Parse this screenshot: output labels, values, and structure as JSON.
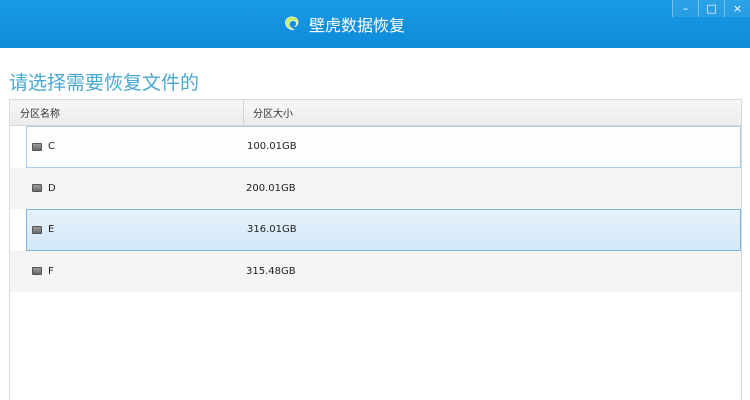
{
  "app": {
    "title": "壁虎数据恢复",
    "icon": "gecko-logo-icon"
  },
  "window_controls": {
    "minimize": "–",
    "maximize": "□",
    "close": "×"
  },
  "headline": "请选择需要恢复文件的",
  "table": {
    "columns": [
      "分区名称",
      "分区大小"
    ],
    "rows": [
      {
        "name": "C",
        "size": "100.01GB",
        "icon": "drive-icon"
      },
      {
        "name": "D",
        "size": "200.01GB",
        "icon": "drive-icon"
      },
      {
        "name": "E",
        "size": "316.01GB",
        "icon": "drive-icon"
      },
      {
        "name": "F",
        "size": "315.48GB",
        "icon": "drive-icon"
      }
    ]
  },
  "colors": {
    "titlebar": "#1a9ae4",
    "headline": "#4aa8d0",
    "selection_border": "#7eb8e6",
    "selection_fill": "#d4e8f8"
  }
}
